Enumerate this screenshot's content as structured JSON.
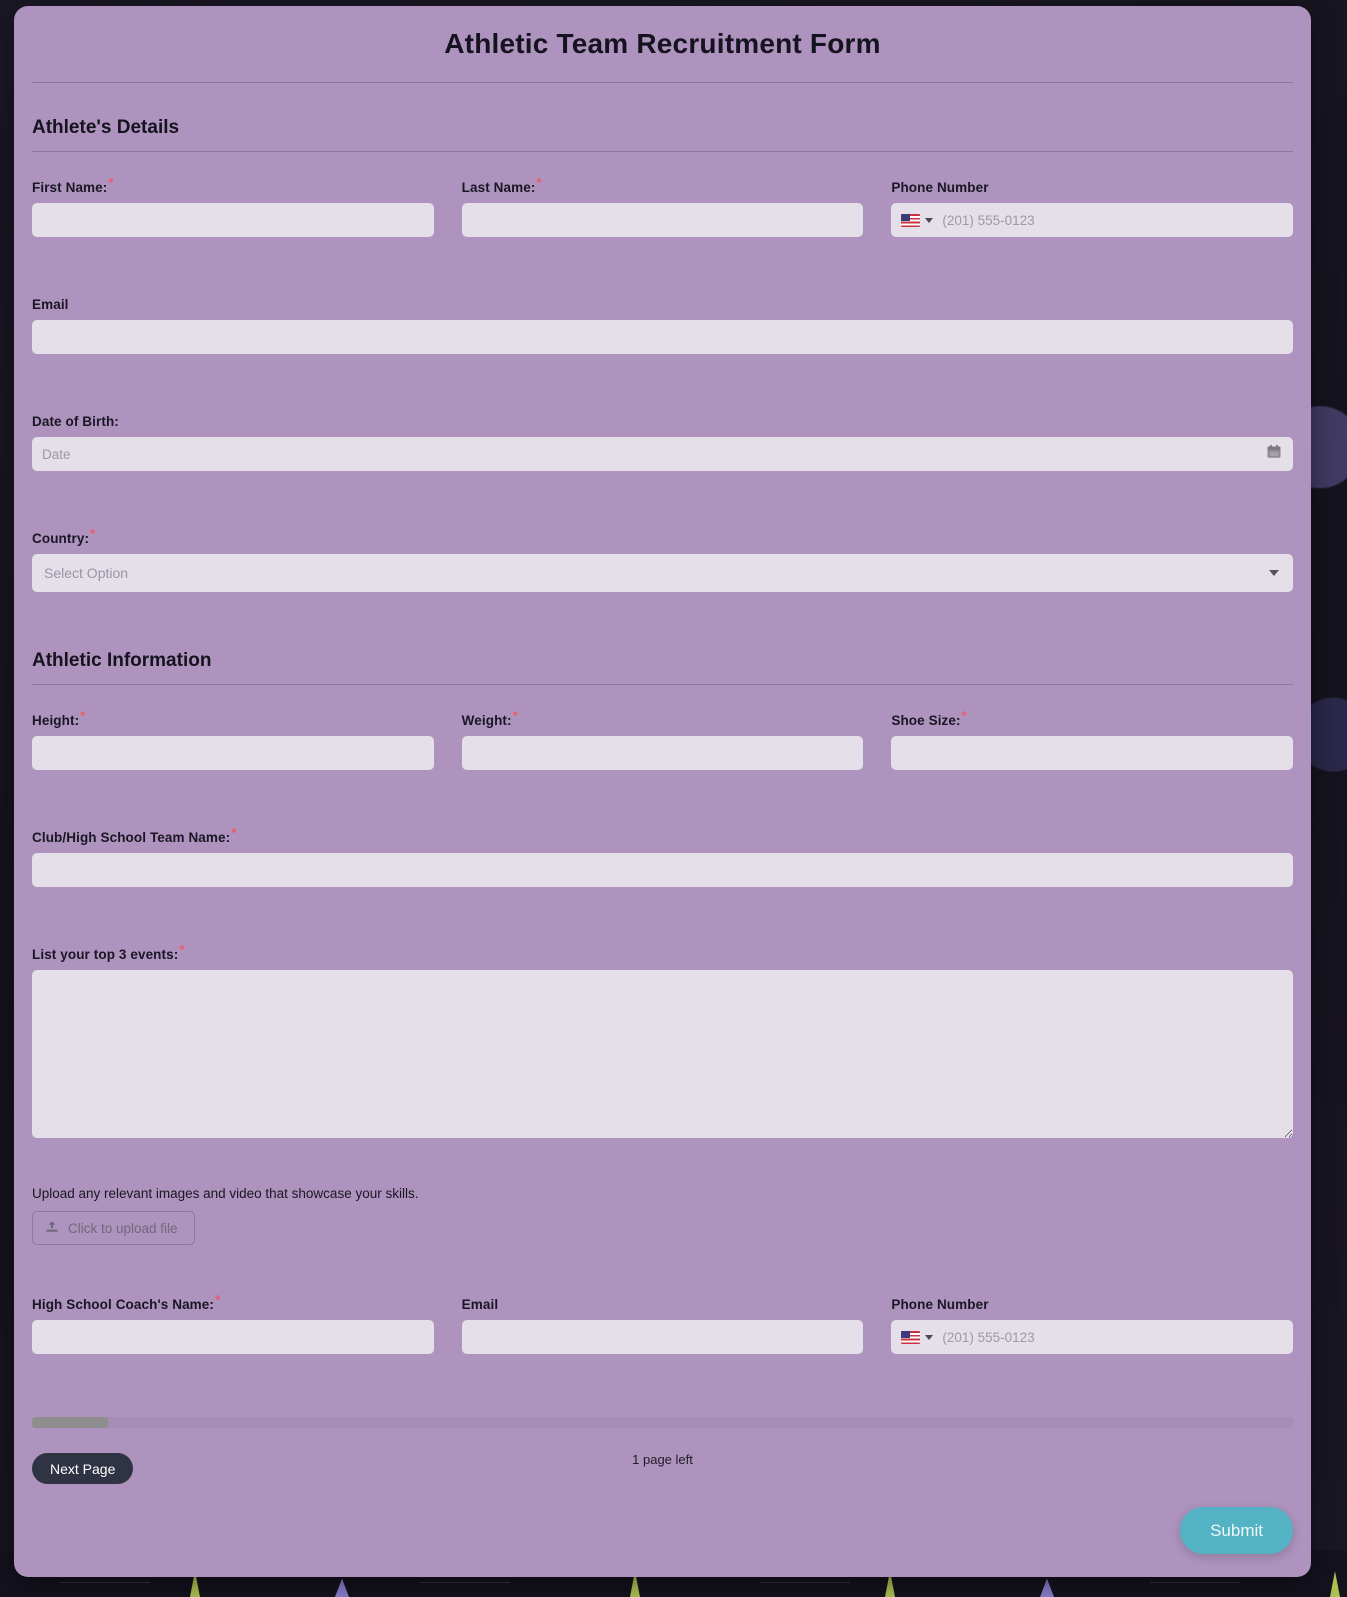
{
  "form": {
    "title": "Athletic Team Recruitment Form"
  },
  "sections": {
    "athlete_details": {
      "heading": "Athlete's Details",
      "first_name": {
        "label": "First Name:",
        "required": "*",
        "value": "",
        "placeholder": ""
      },
      "last_name": {
        "label": "Last Name:",
        "required": "*",
        "value": "",
        "placeholder": ""
      },
      "phone": {
        "label": "Phone Number",
        "placeholder": "(201) 555-0123",
        "country_flag": "us-flag-icon",
        "value": ""
      },
      "email": {
        "label": "Email",
        "value": "",
        "placeholder": ""
      },
      "dob": {
        "label": "Date of Birth:",
        "placeholder": "Date",
        "value": "",
        "icon": "calendar-icon"
      },
      "country": {
        "label": "Country:",
        "required": "*",
        "selected": "Select Option",
        "icon": "chevron-down-icon"
      }
    },
    "athletic_information": {
      "heading": "Athletic Information",
      "height": {
        "label": "Height:",
        "required": "*",
        "value": "",
        "placeholder": ""
      },
      "weight": {
        "label": "Weight:",
        "required": "*",
        "value": "",
        "placeholder": ""
      },
      "shoe_size": {
        "label": "Shoe Size:",
        "required": "*",
        "value": "",
        "placeholder": ""
      },
      "team_name": {
        "label": "Club/High School Team Name:",
        "required": "*",
        "value": "",
        "placeholder": ""
      },
      "top_events": {
        "label": "List your top 3 events:",
        "required": "*",
        "value": "",
        "placeholder": ""
      },
      "upload": {
        "label": "Upload any relevant images and video that showcase your skills.",
        "button_label": "Click to upload file",
        "icon": "upload-icon"
      },
      "coach_name": {
        "label": "High School Coach's Name:",
        "required": "*",
        "value": "",
        "placeholder": ""
      },
      "coach_email": {
        "label": "Email",
        "value": "",
        "placeholder": ""
      },
      "coach_phone": {
        "label": "Phone Number",
        "placeholder": "(201) 555-0123",
        "country_flag": "us-flag-icon",
        "value": ""
      }
    }
  },
  "footer": {
    "progress_percent": 6,
    "pages_left": "1 page left",
    "next_page_label": "Next Page",
    "submit_label": "Submit"
  },
  "colors": {
    "panel_bg": "#ad93bd",
    "input_bg": "#e4dfe9",
    "required_asterisk": "#f2596a",
    "next_page_bg": "#2f3344",
    "submit_bg": "#54b2c5",
    "progress_fill": "#8e8e8e",
    "progress_track": "#a78cb8"
  }
}
